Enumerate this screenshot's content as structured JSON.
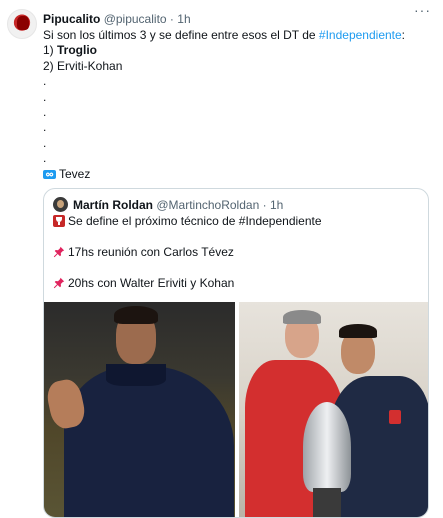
{
  "tweet": {
    "author": {
      "display_name": "Pipucalito",
      "handle": "@pipucalito",
      "separator": "·",
      "time": "1h"
    },
    "more_label": "···",
    "lines": {
      "l1_prefix": "Si son los últimos 3 y se define entre esos el DT de ",
      "l1_hashtag": "#Independiente",
      "l1_suffix": ":",
      "l2_prefix": "1) ",
      "l2_bold": "Troglio",
      "l3": "2) Erviti-Kohan",
      "dots": [
        ".",
        ".",
        ".",
        ".",
        ".",
        "."
      ],
      "last": "Tevez"
    }
  },
  "quote": {
    "author": {
      "display_name": "Martín Roldan",
      "handle": "@MartinchoRoldan",
      "separator": "·",
      "time": "1h"
    },
    "line1_prefix": "Se define el próximo técnico de ",
    "line1_hashtag": "#Independiente",
    "line2": "17hs reunión con Carlos Tévez",
    "line3": "20hs con Walter Eriviti y Kohan"
  },
  "icons": {
    "infinity": "infinity-icon",
    "cup": "trophy-icon",
    "pin": "pushpin-icon"
  },
  "colors": {
    "link": "#1d9bf0",
    "text": "#0f1419",
    "muted": "#536471",
    "border": "#cfd9de"
  }
}
